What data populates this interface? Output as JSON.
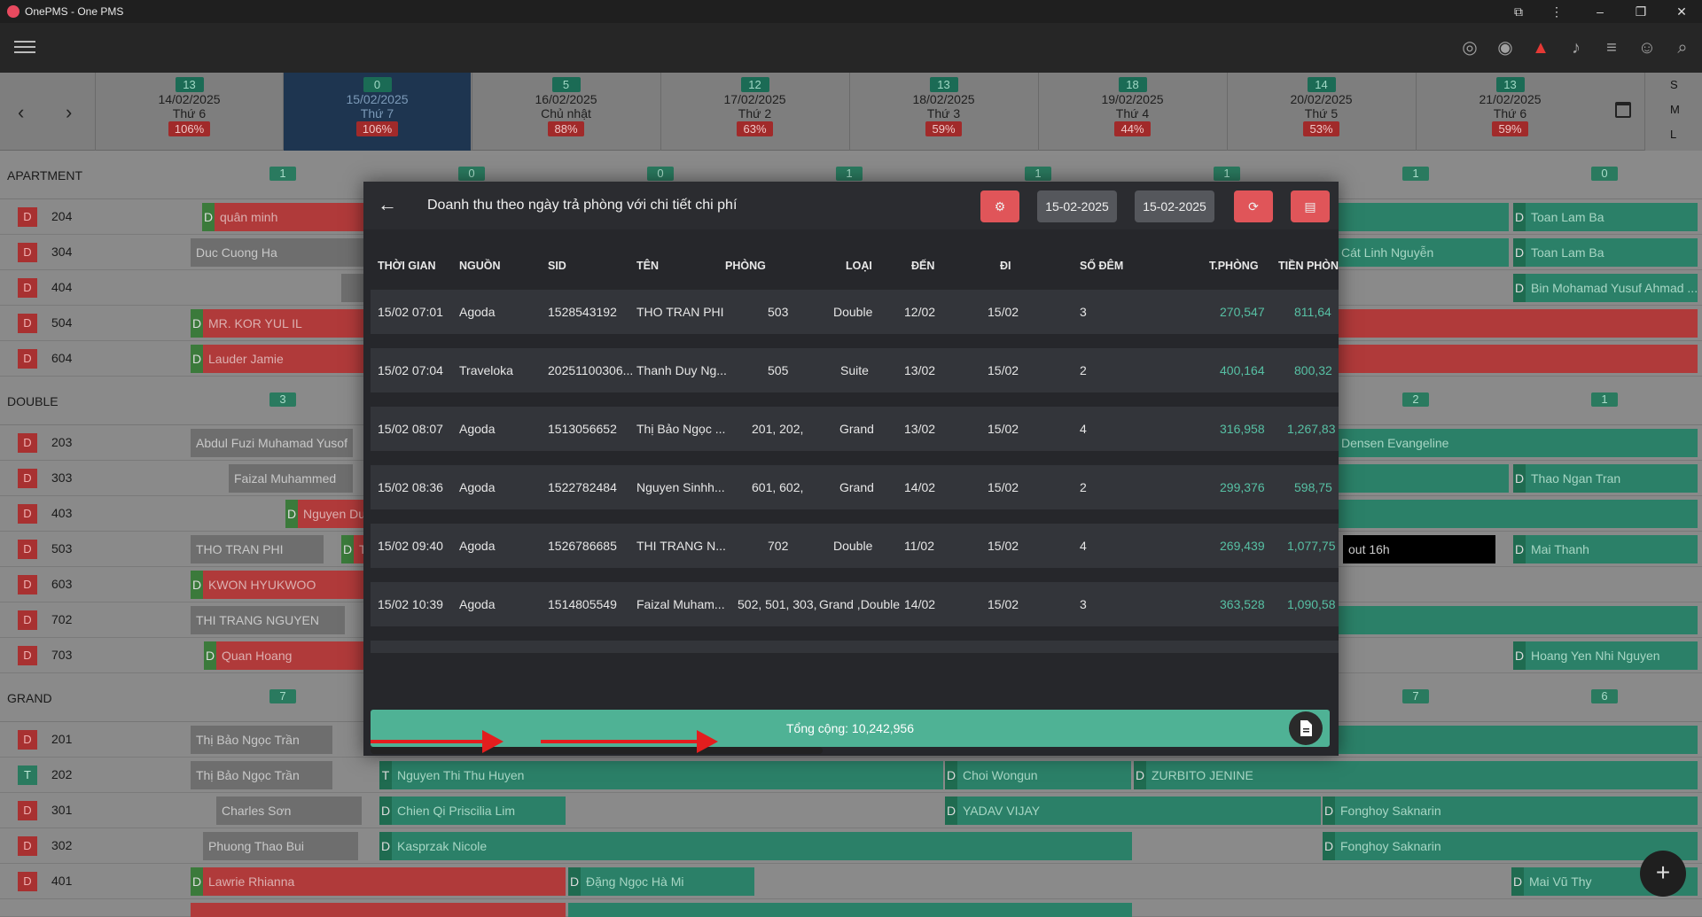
{
  "window": {
    "title": "OnePMS - One PMS"
  },
  "toolbar": {
    "icons": [
      "menu-icon",
      "fingerprint-icon",
      "eye-icon",
      "warning-icon",
      "bell-icon",
      "list-icon",
      "add-user-icon",
      "search-icon"
    ]
  },
  "calendar": {
    "days": [
      {
        "count": "13",
        "date": "14/02/2025",
        "weekday": "Thứ 6",
        "occ": "106%"
      },
      {
        "count": "0",
        "date": "15/02/2025",
        "weekday": "Thứ 7",
        "occ": "106%"
      },
      {
        "count": "5",
        "date": "16/02/2025",
        "weekday": "Chủ nhật",
        "occ": "88%"
      },
      {
        "count": "12",
        "date": "17/02/2025",
        "weekday": "Thứ 2",
        "occ": "63%"
      },
      {
        "count": "13",
        "date": "18/02/2025",
        "weekday": "Thứ 3",
        "occ": "59%"
      },
      {
        "count": "18",
        "date": "19/02/2025",
        "weekday": "Thứ 4",
        "occ": "44%"
      },
      {
        "count": "14",
        "date": "20/02/2025",
        "weekday": "Thứ 5",
        "occ": "53%"
      },
      {
        "count": "13",
        "date": "21/02/2025",
        "weekday": "Thứ 6",
        "occ": "59%"
      }
    ],
    "size_options": [
      "S",
      "M",
      "L"
    ]
  },
  "grid": {
    "apartment": {
      "name": "APARTMENT",
      "counts": [
        "1",
        "0",
        "0",
        "1",
        "1",
        "1",
        "1",
        "0"
      ]
    },
    "double": {
      "name": "DOUBLE",
      "counts": [
        "3",
        "2",
        "1"
      ]
    },
    "grand": {
      "name": "GRAND",
      "counts": [
        "7",
        "7",
        "6"
      ]
    },
    "rooms": [
      {
        "badge": "D",
        "num": "204"
      },
      {
        "badge": "D",
        "num": "304"
      },
      {
        "badge": "D",
        "num": "404"
      },
      {
        "badge": "D",
        "num": "504"
      },
      {
        "badge": "D",
        "num": "604"
      },
      {
        "badge": "D",
        "num": "203"
      },
      {
        "badge": "D",
        "num": "303"
      },
      {
        "badge": "D",
        "num": "403"
      },
      {
        "badge": "D",
        "num": "503"
      },
      {
        "badge": "D",
        "num": "603"
      },
      {
        "badge": "D",
        "num": "702"
      },
      {
        "badge": "D",
        "num": "703"
      },
      {
        "badge": "D",
        "num": "201"
      },
      {
        "badge": "T",
        "num": "202"
      },
      {
        "badge": "D",
        "num": "301"
      },
      {
        "badge": "D",
        "num": "302"
      },
      {
        "badge": "D",
        "num": "401"
      }
    ],
    "bookings": {
      "r204a": "quân minh",
      "r204b": "Toan Lam Ba",
      "r304a": "Duc Cuong Ha",
      "r304b": "Cát Linh Nguyễn",
      "r304c": "Toan Lam Ba",
      "r404a": "Bin Mohamad Yusuf Ahmad ...",
      "r504a": "MR. KOR YUL IL",
      "r604a": "Lauder Jamie",
      "r203a": "Abdul Fuzi Muhamad Yusof",
      "r203b": "Densen Evangeline",
      "r303a": "Faizal Muhammed",
      "r303b": "Thao Ngan Tran",
      "r403a": "Nguyen Du",
      "r503a": "THO TRAN PHI",
      "r503b": "T",
      "r503c": "out 16h",
      "r503d": "Mai Thanh",
      "r603a": "KWON HYUKWOO",
      "r702a": "THI TRANG NGUYEN",
      "r703a": "Quan Hoang",
      "r703b": "Hoang Yen Nhi Nguyen",
      "r201a": "Thị Bảo Ngọc Trần",
      "r202a": "Thị Bảo Ngọc Trần",
      "r202b": "Nguyen Thi Thu Huyen",
      "r202c": "Choi Wongun",
      "r202d": "ZURBITO JENINE",
      "r301a": "Charles Sơn",
      "r301b": "Chien Qi Priscilia Lim",
      "r301c": "YADAV VIJAY",
      "r301d": "Fonghoy Saknarin",
      "r302a": "Phuong Thao Bui",
      "r302b": "Kasprzak Nicole",
      "r302c": "Fonghoy Saknarin",
      "r401a": "Lawrie Rhianna",
      "r401b": "Đặng Ngọc Hà Mi",
      "r401c": "Mai Vũ Thy"
    },
    "tag_d": "D",
    "tag_t": "T"
  },
  "modal": {
    "title": "Doanh thu theo ngày trả phòng với chi tiết chi phí",
    "date_from": "15-02-2025",
    "date_to": "15-02-2025",
    "columns": [
      "THỜI GIAN",
      "NGUỒN",
      "SID",
      "TÊN",
      "PHÒNG",
      "LOẠI",
      "ĐẾN",
      "ĐI",
      "SỐ ĐÊM",
      "T.PHÒNG",
      "TIỀN PHÒN"
    ],
    "rows": [
      {
        "time": "15/02 07:01",
        "source": "Agoda",
        "sid": "1528543192",
        "name": "THO TRAN PHI",
        "room": "503",
        "type": "Double",
        "arrive": "12/02",
        "depart": "15/02",
        "nights": "3",
        "t_room": "270,547",
        "room_money": "811,64"
      },
      {
        "time": "15/02 07:04",
        "source": "Traveloka",
        "sid": "20251100306...",
        "name": "Thanh Duy Ng...",
        "room": "505",
        "type": "Suite",
        "arrive": "13/02",
        "depart": "15/02",
        "nights": "2",
        "t_room": "400,164",
        "room_money": "800,32"
      },
      {
        "time": "15/02 08:07",
        "source": "Agoda",
        "sid": "1513056652",
        "name": "Thị Bảo Ngọc ...",
        "room": "201, 202,",
        "type": "Grand",
        "arrive": "13/02",
        "depart": "15/02",
        "nights": "4",
        "t_room": "316,958",
        "room_money": "1,267,83"
      },
      {
        "time": "15/02 08:36",
        "source": "Agoda",
        "sid": "1522782484",
        "name": "Nguyen Sinhh...",
        "room": "601, 602,",
        "type": "Grand",
        "arrive": "14/02",
        "depart": "15/02",
        "nights": "2",
        "t_room": "299,376",
        "room_money": "598,75"
      },
      {
        "time": "15/02 09:40",
        "source": "Agoda",
        "sid": "1526786685",
        "name": "THI TRANG N...",
        "room": "702",
        "type": "Double",
        "arrive": "11/02",
        "depart": "15/02",
        "nights": "4",
        "t_room": "269,439",
        "room_money": "1,077,75"
      },
      {
        "time": "15/02 10:39",
        "source": "Agoda",
        "sid": "1514805549",
        "name": "Faizal Muham...",
        "room": "502, 501, 303,",
        "type": "Grand ,Double",
        "arrive": "14/02",
        "depart": "15/02",
        "nights": "3",
        "t_room": "363,528",
        "room_money": "1,090,58"
      }
    ],
    "total": "Tổng cộng: 10,242,956"
  },
  "fab": {
    "label": "+"
  }
}
